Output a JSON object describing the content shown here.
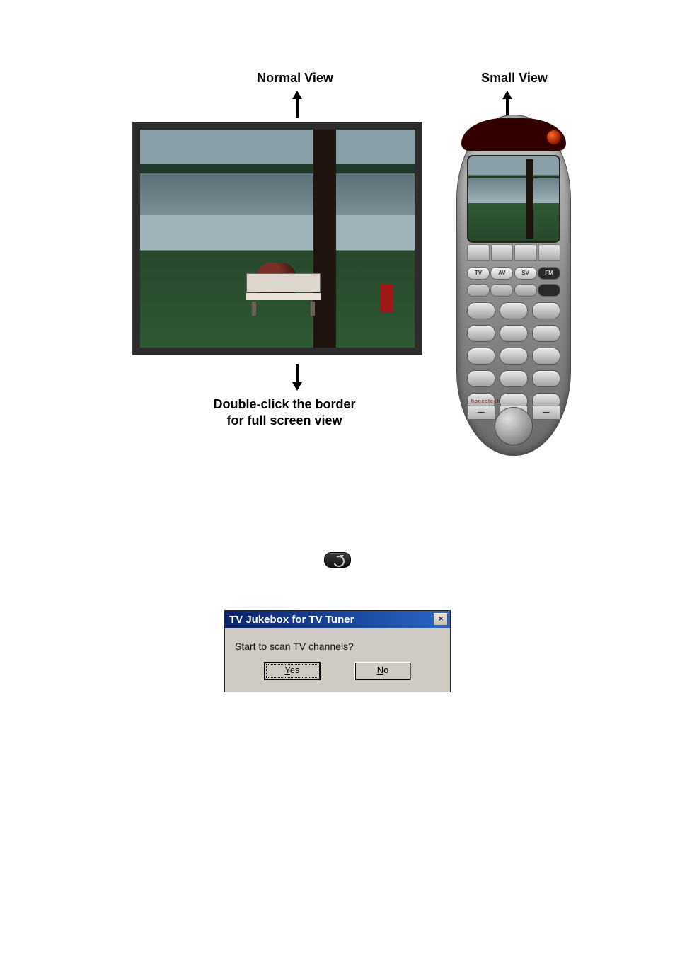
{
  "figure": {
    "normal_label": "Normal View",
    "small_label": "Small View",
    "fullscreen_hint_line1": "Double-click the border",
    "fullscreen_hint_line2": "for full screen view"
  },
  "remote": {
    "modes": [
      "TV",
      "AV",
      "SV",
      "FM"
    ],
    "bottom_buttons": [
      "—",
      "?",
      "—"
    ],
    "brand": "honestech"
  },
  "icon": {
    "refresh": "refresh"
  },
  "dialog": {
    "title": "TV Jukebox for TV Tuner",
    "message": "Start to scan TV channels?",
    "yes": "Yes",
    "no": "No"
  }
}
